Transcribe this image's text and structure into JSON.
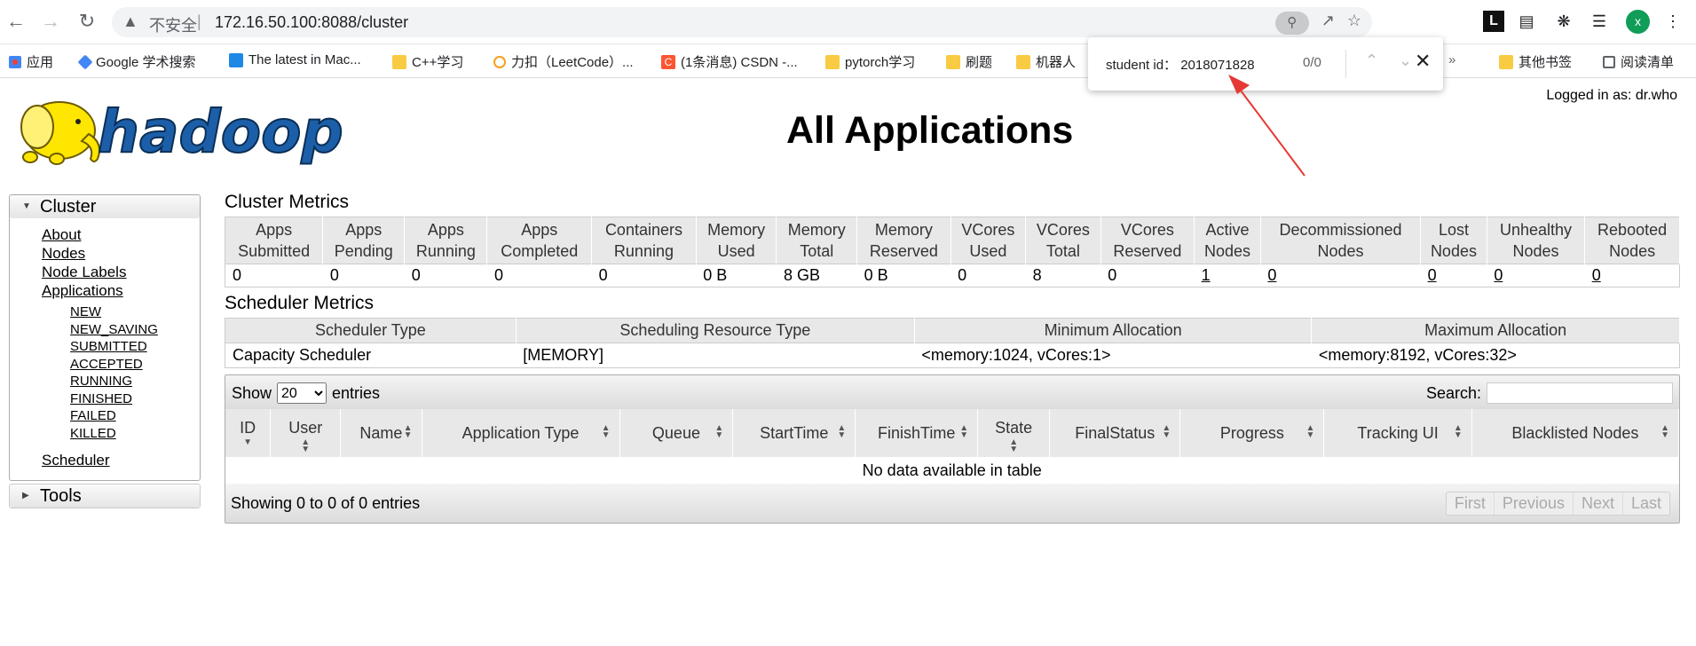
{
  "browser": {
    "security_label": "不安全",
    "url": "172.16.50.100:8088/cluster",
    "profile_initial": "x",
    "ext_letter": "L"
  },
  "bookmarks": [
    {
      "label": "应用",
      "icon": "apps-grid-icon"
    },
    {
      "label": "Google 学术搜索",
      "icon": "google-scholar-icon"
    },
    {
      "label": "The latest in Mac...",
      "icon": "mac-icon"
    },
    {
      "label": "C++学习",
      "icon": "folder-icon"
    },
    {
      "label": "力扣（LeetCode）...",
      "icon": "leetcode-icon"
    },
    {
      "label": "(1条消息) CSDN -...",
      "icon": "csdn-icon"
    },
    {
      "label": "pytorch学习",
      "icon": "folder-icon"
    },
    {
      "label": "刷题",
      "icon": "folder-icon"
    },
    {
      "label": "机器人",
      "icon": "folder-icon"
    },
    {
      "label": "其他书签",
      "icon": "folder-icon"
    },
    {
      "label": "阅读清单",
      "icon": "reading-list-icon"
    }
  ],
  "findbar": {
    "query": "student id： 2018071828",
    "count": "0/0"
  },
  "page": {
    "logged_in": "Logged in as: dr.who",
    "title": "All Applications",
    "nav": {
      "cluster_label": "Cluster",
      "links": [
        "About",
        "Nodes",
        "Node Labels",
        "Applications"
      ],
      "app_states": [
        "NEW",
        "NEW_SAVING",
        "SUBMITTED",
        "ACCEPTED",
        "RUNNING",
        "FINISHED",
        "FAILED",
        "KILLED"
      ],
      "scheduler": "Scheduler",
      "tools_label": "Tools"
    },
    "cluster_metrics": {
      "title": "Cluster Metrics",
      "headers": [
        [
          "Apps",
          "Submitted"
        ],
        [
          "Apps",
          "Pending"
        ],
        [
          "Apps",
          "Running"
        ],
        [
          "Apps",
          "Completed"
        ],
        [
          "Containers",
          "Running"
        ],
        [
          "Memory",
          "Used"
        ],
        [
          "Memory",
          "Total"
        ],
        [
          "Memory",
          "Reserved"
        ],
        [
          "VCores",
          "Used"
        ],
        [
          "VCores",
          "Total"
        ],
        [
          "VCores",
          "Reserved"
        ],
        [
          "Active",
          "Nodes"
        ],
        [
          "Decommissioned",
          "Nodes"
        ],
        [
          "Lost",
          "Nodes"
        ],
        [
          "Unhealthy",
          "Nodes"
        ],
        [
          "Rebooted",
          "Nodes"
        ]
      ],
      "values": [
        "0",
        "0",
        "0",
        "0",
        "0",
        "0 B",
        "8 GB",
        "0 B",
        "0",
        "8",
        "0",
        "1",
        "0",
        "0",
        "0",
        "0"
      ]
    },
    "scheduler_metrics": {
      "title": "Scheduler Metrics",
      "headers": [
        "Scheduler Type",
        "Scheduling Resource Type",
        "Minimum Allocation",
        "Maximum Allocation"
      ],
      "row": [
        "Capacity Scheduler",
        "[MEMORY]",
        "<memory:1024, vCores:1>",
        "<memory:8192, vCores:32>"
      ]
    },
    "apps_table": {
      "show_label": "Show",
      "page_size": "20",
      "entries_label": "entries",
      "search_label": "Search:",
      "headers": [
        "ID",
        "User",
        "Name",
        "Application Type",
        "Queue",
        "StartTime",
        "FinishTime",
        "State",
        "FinalStatus",
        "Progress",
        "Tracking UI",
        "Blacklisted Nodes"
      ],
      "empty_text": "No data available in table",
      "info": "Showing 0 to 0 of 0 entries",
      "pager": [
        "First",
        "Previous",
        "Next",
        "Last"
      ]
    }
  },
  "colors": {
    "annotation_arrow": "#e53935",
    "profile": "#0f9d58",
    "logo_yellow": "#ffe600"
  }
}
